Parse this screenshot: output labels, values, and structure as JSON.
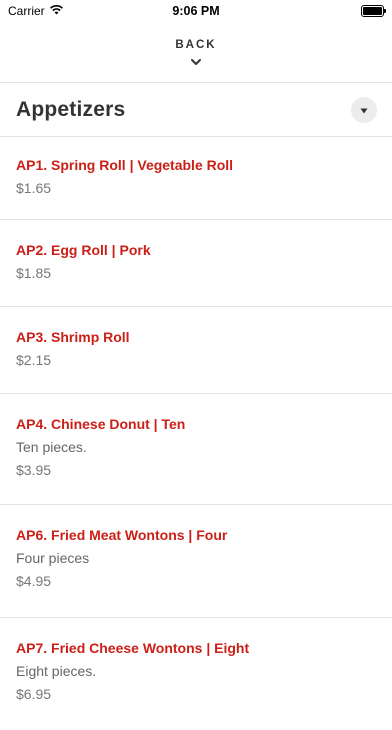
{
  "status_bar": {
    "carrier": "Carrier",
    "time": "9:06 PM",
    "battery_level": 1.0
  },
  "nav": {
    "back_label": "BACK",
    "back_icon": "chevron-down-icon"
  },
  "section": {
    "title": "Appetizers",
    "toggle_icon": "triangle-down-icon"
  },
  "items": [
    {
      "name": "AP1. Spring Roll | Vegetable Roll",
      "description": "",
      "price": "$1.65"
    },
    {
      "name": "AP2. Egg Roll | Pork",
      "description": "",
      "price": "$1.85"
    },
    {
      "name": "AP3. Shrimp Roll",
      "description": "",
      "price": "$2.15"
    },
    {
      "name": "AP4. Chinese Donut | Ten",
      "description": "Ten pieces.",
      "price": "$3.95"
    },
    {
      "name": "AP6. Fried Meat Wontons | Four",
      "description": "Four pieces",
      "price": "$4.95"
    },
    {
      "name": "AP7. Fried Cheese Wontons | Eight",
      "description": "Eight pieces.",
      "price": "$6.95"
    }
  ],
  "colors": {
    "item_name": "#cc1f17",
    "price": "#777777",
    "divider": "#e4e4e4"
  }
}
